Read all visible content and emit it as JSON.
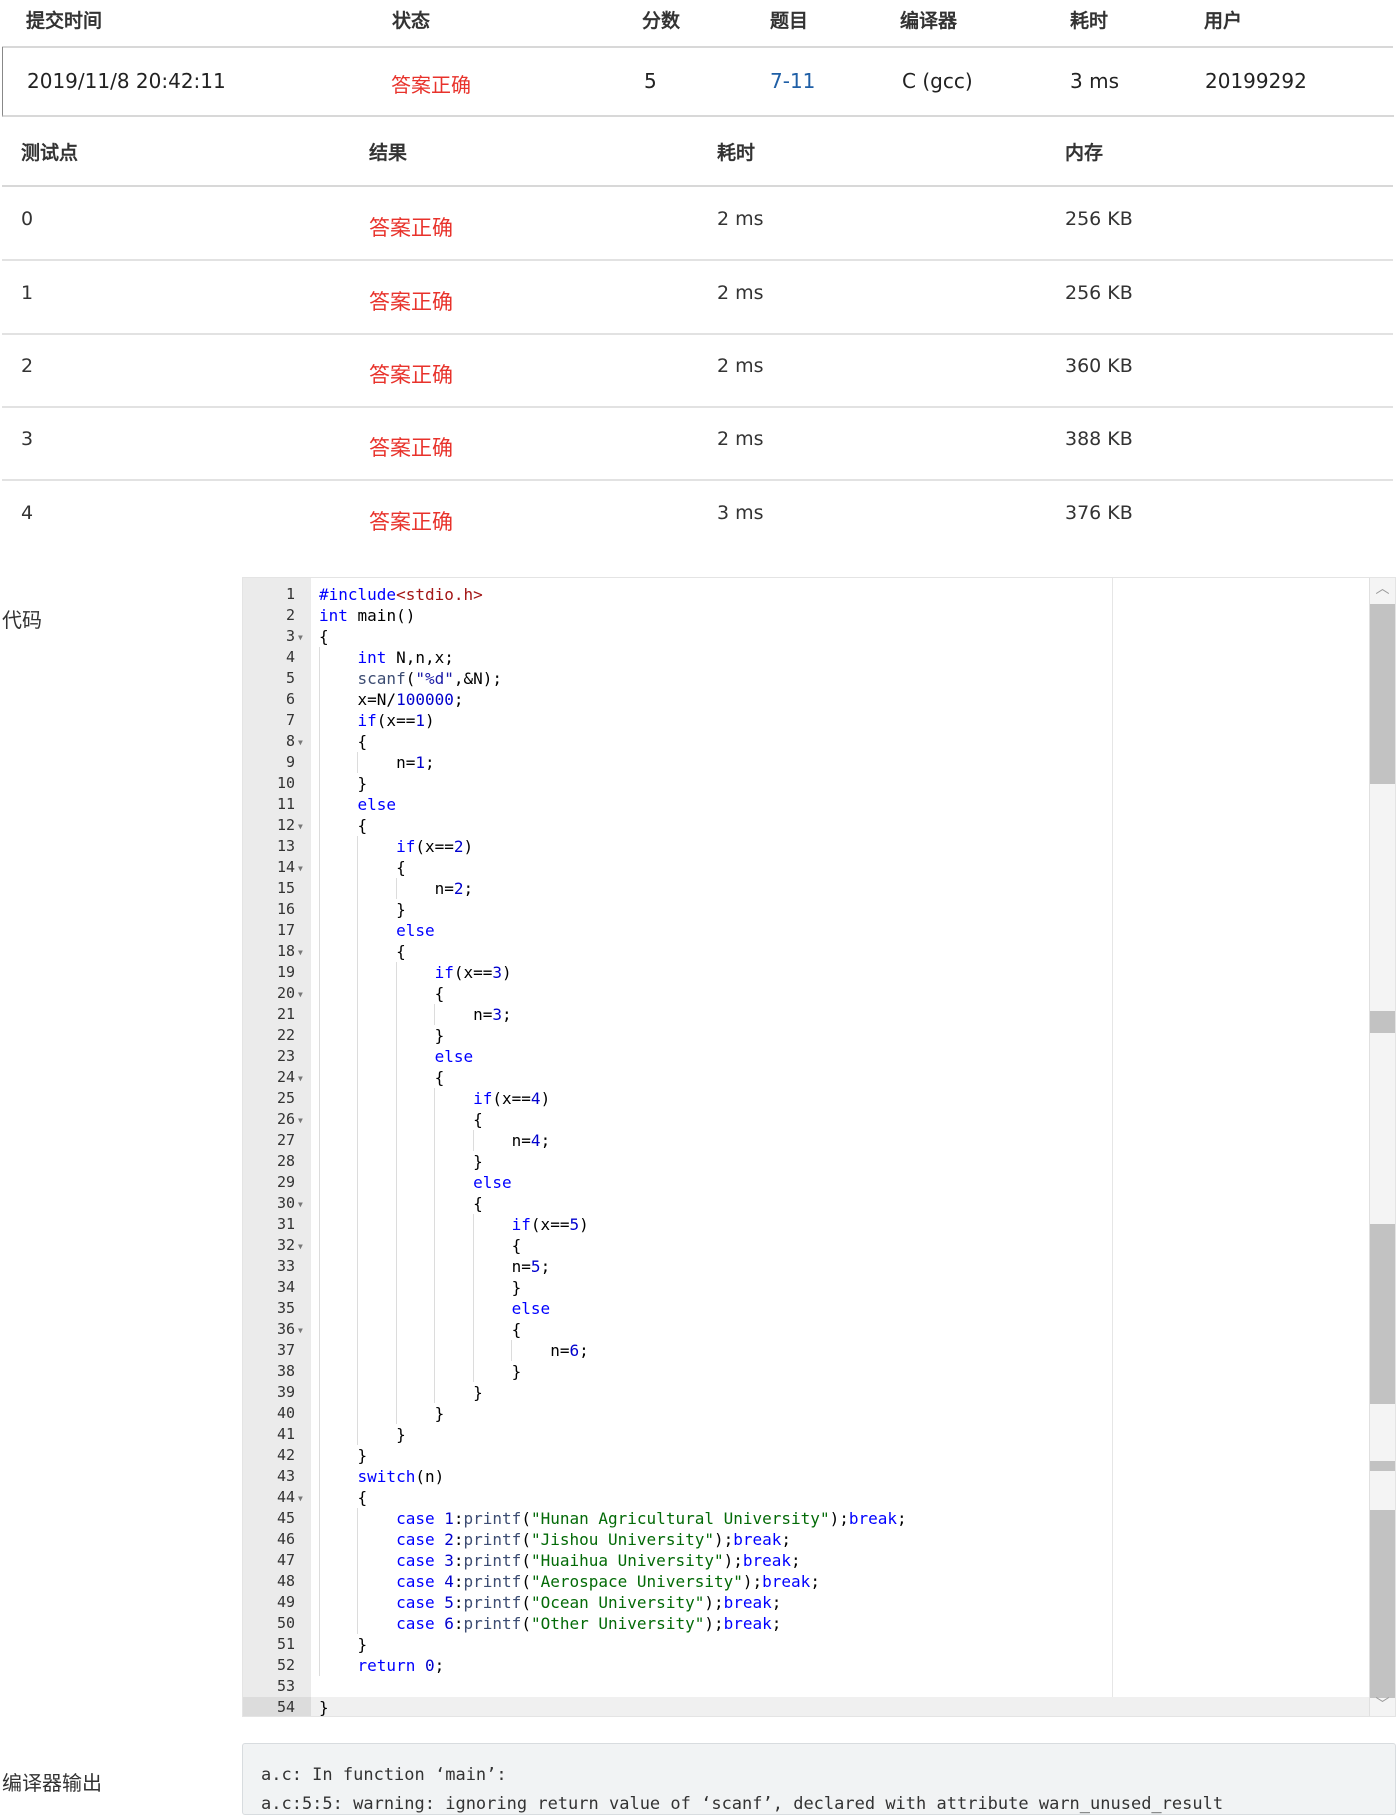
{
  "submission": {
    "headers": [
      "提交时间",
      "状态",
      "分数",
      "题目",
      "编译器",
      "耗时",
      "用户"
    ],
    "time": "2019/11/8 20:42:11",
    "status": "答案正确",
    "score": "5",
    "problem": "7-11",
    "compiler": "C (gcc)",
    "duration": "3 ms",
    "user": "20199292"
  },
  "testpoints": {
    "headers": [
      "测试点",
      "结果",
      "耗时",
      "内存"
    ],
    "rows": [
      {
        "id": "0",
        "result": "答案正确",
        "time": "2 ms",
        "memory": "256 KB"
      },
      {
        "id": "1",
        "result": "答案正确",
        "time": "2 ms",
        "memory": "256 KB"
      },
      {
        "id": "2",
        "result": "答案正确",
        "time": "2 ms",
        "memory": "360 KB"
      },
      {
        "id": "3",
        "result": "答案正确",
        "time": "2 ms",
        "memory": "388 KB"
      },
      {
        "id": "4",
        "result": "答案正确",
        "time": "3 ms",
        "memory": "376 KB"
      }
    ]
  },
  "code_label": "代码",
  "code_lines": [
    "#include<stdio.h>",
    "int main()",
    "{",
    "    int N,n,x;",
    "    scanf(\"%d\",&N);",
    "    x=N/100000;",
    "    if(x==1)",
    "    {",
    "        n=1;",
    "    }",
    "    else",
    "    {",
    "        if(x==2)",
    "        {",
    "            n=2;",
    "        }",
    "        else",
    "        {",
    "            if(x==3)",
    "            {",
    "                n=3;",
    "            }",
    "            else",
    "            {",
    "                if(x==4)",
    "                {",
    "                    n=4;",
    "                }",
    "                else",
    "                {",
    "                    if(x==5)",
    "                    {",
    "                    n=5;",
    "                    }",
    "                    else",
    "                    {",
    "                        n=6;",
    "                    }",
    "                }",
    "            }",
    "        }",
    "    }",
    "    switch(n)",
    "    {",
    "        case 1:printf(\"Hunan Agricultural University\");break;",
    "        case 2:printf(\"Jishou University\");break;",
    "        case 3:printf(\"Huaihua University\");break;",
    "        case 4:printf(\"Aerospace University\");break;",
    "        case 5:printf(\"Ocean University\");break;",
    "        case 6:printf(\"Other University\");break;",
    "    }",
    "    return 0;",
    "",
    "}"
  ],
  "fold_lines": [
    3,
    8,
    12,
    14,
    18,
    20,
    24,
    26,
    30,
    32,
    36,
    44
  ],
  "active_line": 54,
  "compiler_label": "编译器输出",
  "compiler_output": [
    "a.c: In function ‘main’:",
    "a.c:5:5: warning: ignoring return value of ‘scanf’, declared with attribute warn_unused_result"
  ],
  "colors": {
    "status_accent": "#e8322b",
    "link": "#1f5fa6",
    "keyword": "#0000ff",
    "string": "#036a07"
  }
}
